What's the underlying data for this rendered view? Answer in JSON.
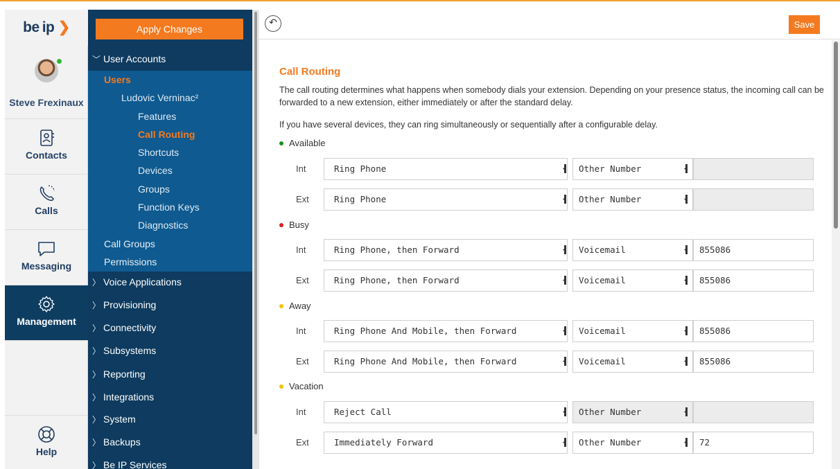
{
  "brand": {
    "logo_text": "be ip",
    "accent": "#f47a20",
    "nav_bg": "#0e3b5f",
    "nav_sub_bg": "#0f5a90"
  },
  "user": {
    "name": "Steve Frexinaux",
    "status_color": "#2eb82e"
  },
  "rail": {
    "contacts": "Contacts",
    "calls": "Calls",
    "messaging": "Messaging",
    "management": "Management",
    "help": "Help"
  },
  "nav": {
    "apply_label": "Apply Changes",
    "user_accounts": "User Accounts",
    "users": "Users",
    "user_entry": "Ludovic Verninac²",
    "features": "Features",
    "call_routing": "Call Routing",
    "shortcuts": "Shortcuts",
    "devices": "Devices",
    "groups": "Groups",
    "function_keys": "Function Keys",
    "diagnostics": "Diagnostics",
    "call_groups": "Call Groups",
    "permissions": "Permissions",
    "voice_applications": "Voice Applications",
    "provisioning": "Provisioning",
    "connectivity": "Connectivity",
    "subsystems": "Subsystems",
    "reporting": "Reporting",
    "integrations": "Integrations",
    "system": "System",
    "backups": "Backups",
    "be_ip_services": "Be IP Services"
  },
  "toolbar": {
    "back_icon": "↶",
    "save_label": "Save"
  },
  "page": {
    "title": "Call Routing",
    "description_1": "The call routing determines what happens when somebody dials your extension. Depending on your presence status, the incoming call can be forwarded to a new extension, either immediately or after the standard delay.",
    "description_2": "If you have several devices, they can ring simultaneously or sequentially after a configurable delay."
  },
  "routing": {
    "available": {
      "label": "Available",
      "color": "#1e8f1e",
      "int": {
        "kind": "Int",
        "action": "Ring Phone",
        "target": "Other Number",
        "value": ""
      },
      "ext": {
        "kind": "Ext",
        "action": "Ring Phone",
        "target": "Other Number",
        "value": ""
      }
    },
    "busy": {
      "label": "Busy",
      "color": "#e01e1e",
      "int": {
        "kind": "Int",
        "action": "Ring Phone, then Forward",
        "target": "Voicemail",
        "value": "855086"
      },
      "ext": {
        "kind": "Ext",
        "action": "Ring Phone, then Forward",
        "target": "Voicemail",
        "value": "855086"
      }
    },
    "away": {
      "label": "Away",
      "color": "#f2c200",
      "int": {
        "kind": "Int",
        "action": "Ring Phone And Mobile, then Forward",
        "target": "Voicemail",
        "value": "855086"
      },
      "ext": {
        "kind": "Ext",
        "action": "Ring Phone And Mobile, then Forward",
        "target": "Voicemail",
        "value": "855086"
      }
    },
    "vacation": {
      "label": "Vacation",
      "color": "#f2c200",
      "int": {
        "kind": "Int",
        "action": "Reject Call",
        "target": "Other Number",
        "value": ""
      },
      "ext": {
        "kind": "Ext",
        "action": "Immediately Forward",
        "target": "Other Number",
        "value": "72"
      }
    }
  }
}
